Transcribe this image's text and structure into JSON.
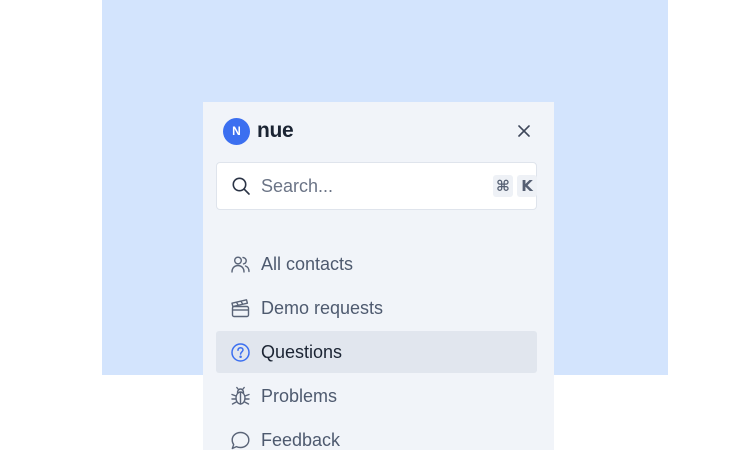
{
  "app": {
    "brand_name": "nue",
    "logo_letter": "N"
  },
  "search": {
    "placeholder": "Search...",
    "shortcut": [
      "⌘",
      "K"
    ]
  },
  "nav": {
    "items": [
      {
        "label": "All contacts",
        "icon": "users-icon",
        "active": false
      },
      {
        "label": "Demo requests",
        "icon": "clapperboard-icon",
        "active": false
      },
      {
        "label": "Questions",
        "icon": "question-circle-icon",
        "active": true
      },
      {
        "label": "Problems",
        "icon": "bug-icon",
        "active": false
      },
      {
        "label": "Feedback",
        "icon": "chat-bubble-icon",
        "active": false
      }
    ]
  },
  "colors": {
    "accent": "#3b6ff0",
    "backdrop": "#d3e4fd",
    "panel": "#f1f4f9"
  }
}
